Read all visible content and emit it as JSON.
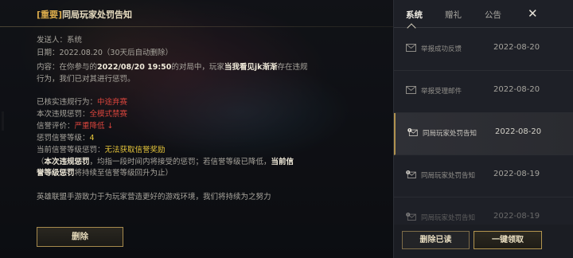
{
  "mail": {
    "title_tag": "[重要]",
    "title": "同局玩家处罚告知",
    "sender_label": "发送人：",
    "sender": "系统",
    "date_label": "日期：",
    "date": "2022.08.20（30天后自动删除）",
    "content_p1_a": "内容：在你参与的",
    "content_p1_time": "2022/08/20 19:50",
    "content_p1_b": "的对局中，玩家",
    "content_p1_player": "当我看见jk渐渐",
    "content_p1_c": "存在违规",
    "content_p1_line2": "行为，我们已对其进行惩罚。",
    "verified_label": "已核实违规行为：",
    "verified_value": "中途弃赛",
    "penalty_label": "本次违规惩罚：",
    "penalty_value": "全模式禁赛",
    "credit_label": "信誉评价：",
    "credit_value": "严重降低 ↓",
    "penalty_level_label": "惩罚信誉等级：",
    "penalty_level_value": "4",
    "current_level_label": "当前信誉等级惩罚：",
    "current_level_value": "无法获取信誉奖励",
    "note_a": "（",
    "note_b": "本次违规惩罚",
    "note_c": "，均指一段时间内将接受的惩罚；若信誉等级已降低，",
    "note_d": "当前信",
    "note_e": "誉等级惩罚",
    "note_f": "将持续至信誉等级回升为止）",
    "footer": "英雄联盟手游致力于为玩家营造更好的游戏环境，我们将持续为之努力",
    "delete_label": "删除"
  },
  "tabs": [
    {
      "label": "系统"
    },
    {
      "label": "赠礼"
    },
    {
      "label": "公告"
    }
  ],
  "close_label": "✕",
  "mail_list": [
    {
      "subject": "举报成功反馈",
      "date": "2022-08-20",
      "icon": "envelope-icon"
    },
    {
      "subject": "举报受理邮件",
      "date": "2022-08-20",
      "icon": "envelope-icon"
    },
    {
      "subject": "同局玩家处罚告知",
      "date": "2022-08-20",
      "icon": "important-envelope-icon"
    },
    {
      "subject": "同局玩家处罚告知",
      "date": "2022-08-19",
      "icon": "important-envelope-icon"
    },
    {
      "subject": "同局玩家处罚告知",
      "date": "2022-08-19",
      "icon": "important-envelope-icon"
    }
  ],
  "bottom": {
    "delete_read_label": "删除已读",
    "claim_all_label": "一键领取"
  },
  "colors": {
    "accent_gold": "#b0924f",
    "warning_red": "#d8443c",
    "highlight_yellow": "#e6c53a"
  }
}
